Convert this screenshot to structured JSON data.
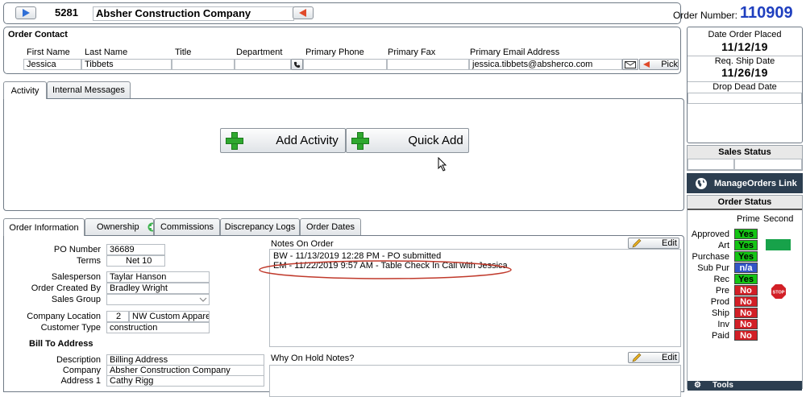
{
  "header": {
    "customer_number": "5281",
    "customer_name": "Absher Construction Company",
    "order_number_label": "Order Number:",
    "order_number": "110909"
  },
  "order_contact": {
    "title": "Order Contact",
    "columns": [
      "First Name",
      "Last Name",
      "Title",
      "Department",
      "Primary Phone",
      "Primary Fax",
      "Primary Email Address"
    ],
    "first_name": "Jessica",
    "last_name": "Tibbets",
    "title_value": "",
    "department": "",
    "phone": "",
    "fax": "",
    "email": "jessica.tibbets@absherco.com",
    "pick_label": "Pick"
  },
  "dates": {
    "date_ordered_label": "Date Order Placed",
    "date_ordered": "11/12/19",
    "req_ship_label": "Req. Ship Date",
    "req_ship": "11/26/19",
    "drop_dead_label": "Drop Dead Date",
    "drop_dead": ""
  },
  "activity": {
    "tabs": [
      "Activity",
      "Internal Messages"
    ],
    "add_activity_label": "Add Activity",
    "quick_add_label": "Quick Add"
  },
  "sales_status": {
    "title": "Sales Status"
  },
  "manage_orders_link": {
    "label": "ManageOrders Link"
  },
  "order_status": {
    "title": "Order Status",
    "col_prime": "Prime",
    "col_second": "Second",
    "rows": [
      {
        "label": "Approved",
        "prime": "Yes"
      },
      {
        "label": "Art",
        "prime": "Yes"
      },
      {
        "label": "Purchase",
        "prime": "Yes"
      },
      {
        "label": "Sub Pur",
        "prime": "n/a"
      },
      {
        "label": "Rec",
        "prime": "Yes"
      },
      {
        "label": "Pre",
        "prime": "No"
      },
      {
        "label": "Prod",
        "prime": "No"
      },
      {
        "label": "Ship",
        "prime": "No"
      },
      {
        "label": "Inv",
        "prime": "No"
      },
      {
        "label": "Paid",
        "prime": "No"
      }
    ],
    "stop_label": "STOP"
  },
  "tools": {
    "label": "Tools"
  },
  "info_tabs": [
    "Order Information",
    "Ownership",
    "Commissions",
    "Discrepancy Logs",
    "Order Dates"
  ],
  "order_info": {
    "po_number_label": "PO Number",
    "po_number": "36689",
    "terms_label": "Terms",
    "terms": "Net 10",
    "salesperson_label": "Salesperson",
    "salesperson": "Taylar Hanson",
    "created_by_label": "Order Created By",
    "created_by": "Bradley Wright",
    "sales_group_label": "Sales Group",
    "sales_group": "",
    "company_location_label": "Company Location",
    "company_location_num": "2",
    "company_location": "NW Custom Apparel",
    "customer_type_label": "Customer Type",
    "customer_type": "construction",
    "bill_to_title": "Bill To Address",
    "description_label": "Description",
    "description": "Billing Address",
    "company_label": "Company",
    "company": "Absher Construction Company",
    "address1_label": "Address 1",
    "address1": "Cathy Rigg"
  },
  "notes": {
    "title": "Notes On Order",
    "edit_label": "Edit",
    "lines": [
      "BW - 11/13/2019 12:28 PM - PO submitted",
      "EM - 11/22/2019 9:57 AM - Table Check In Call with Jessica"
    ]
  },
  "hold_notes": {
    "title": "Why On Hold Notes?",
    "edit_label": "Edit"
  }
}
